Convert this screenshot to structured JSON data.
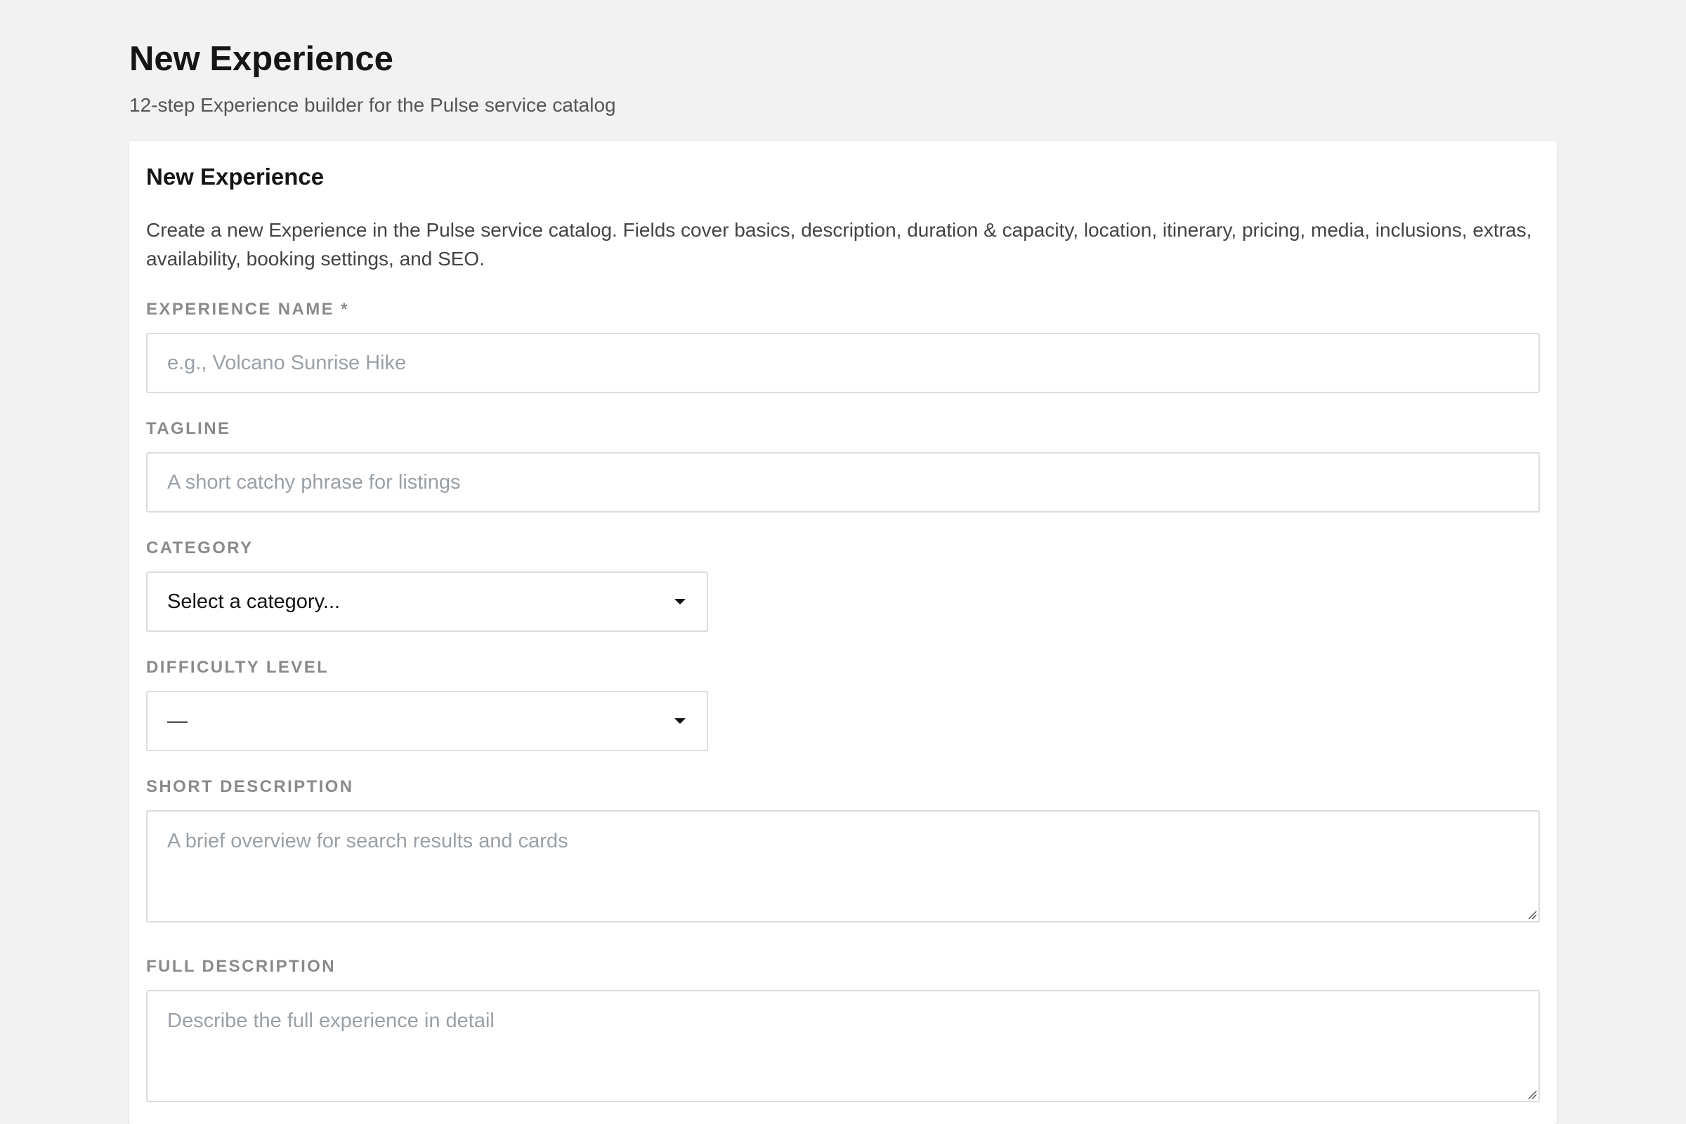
{
  "header": {
    "title": "New Experience",
    "subtitle": "12-step Experience builder for the Pulse service catalog"
  },
  "card": {
    "title": "New Experience",
    "description": "Create a new Experience in the Pulse service catalog. Fields cover basics, description, duration & capacity, location, itinerary, pricing, media, inclusions, extras, availability, booking settings, and SEO."
  },
  "fields": {
    "experience_name": {
      "label": "EXPERIENCE NAME *",
      "value": "",
      "placeholder": "e.g., Volcano Sunrise Hike"
    },
    "tagline": {
      "label": "TAGLINE",
      "value": "",
      "placeholder": "A short catchy phrase for listings"
    },
    "category": {
      "label": "CATEGORY",
      "selected": "Select a category..."
    },
    "difficulty_level": {
      "label": "DIFFICULTY LEVEL",
      "selected": "—"
    },
    "short_description": {
      "label": "SHORT DESCRIPTION",
      "value": "",
      "placeholder": "A brief overview for search results and cards"
    },
    "full_description": {
      "label": "FULL DESCRIPTION",
      "value": "",
      "placeholder": "Describe the full experience in detail"
    }
  },
  "icons": {
    "select_caret": "caret-down-icon",
    "resize_handle": "resize-grip-icon"
  }
}
